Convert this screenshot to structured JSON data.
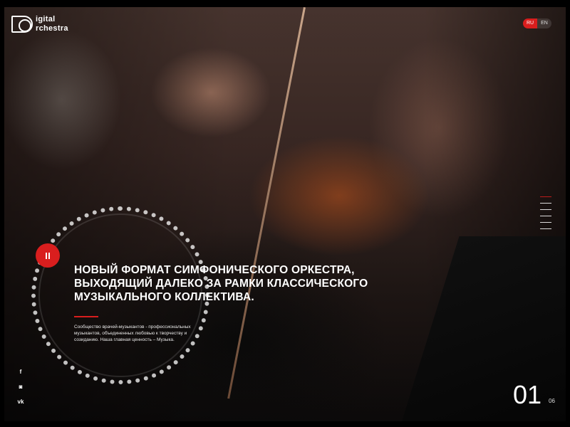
{
  "brand": {
    "line1": "igital",
    "line2": "rchestra"
  },
  "lang": {
    "active": "RU",
    "inactive": "EN"
  },
  "hero": {
    "headline": "Новый формат симфонического оркестра, выходящий далеко за рамки классического музыкального коллектива.",
    "description": "Сообщество врачей-музыкантов - профессиональных музыкантов, объединенных любовью к творчеству и созиданию. Наша главная ценность – Музыка."
  },
  "socials": [
    {
      "icon": "facebook-icon",
      "glyph": "f"
    },
    {
      "icon": "instagram-icon",
      "glyph": "◙"
    },
    {
      "icon": "vk-icon",
      "glyph": "vk"
    }
  ],
  "slider": {
    "current": "01",
    "total": "06",
    "slide_count": 6,
    "current_index": 1
  },
  "colors": {
    "accent": "#d91e1e",
    "text": "#ffffff",
    "background": "#000000"
  }
}
